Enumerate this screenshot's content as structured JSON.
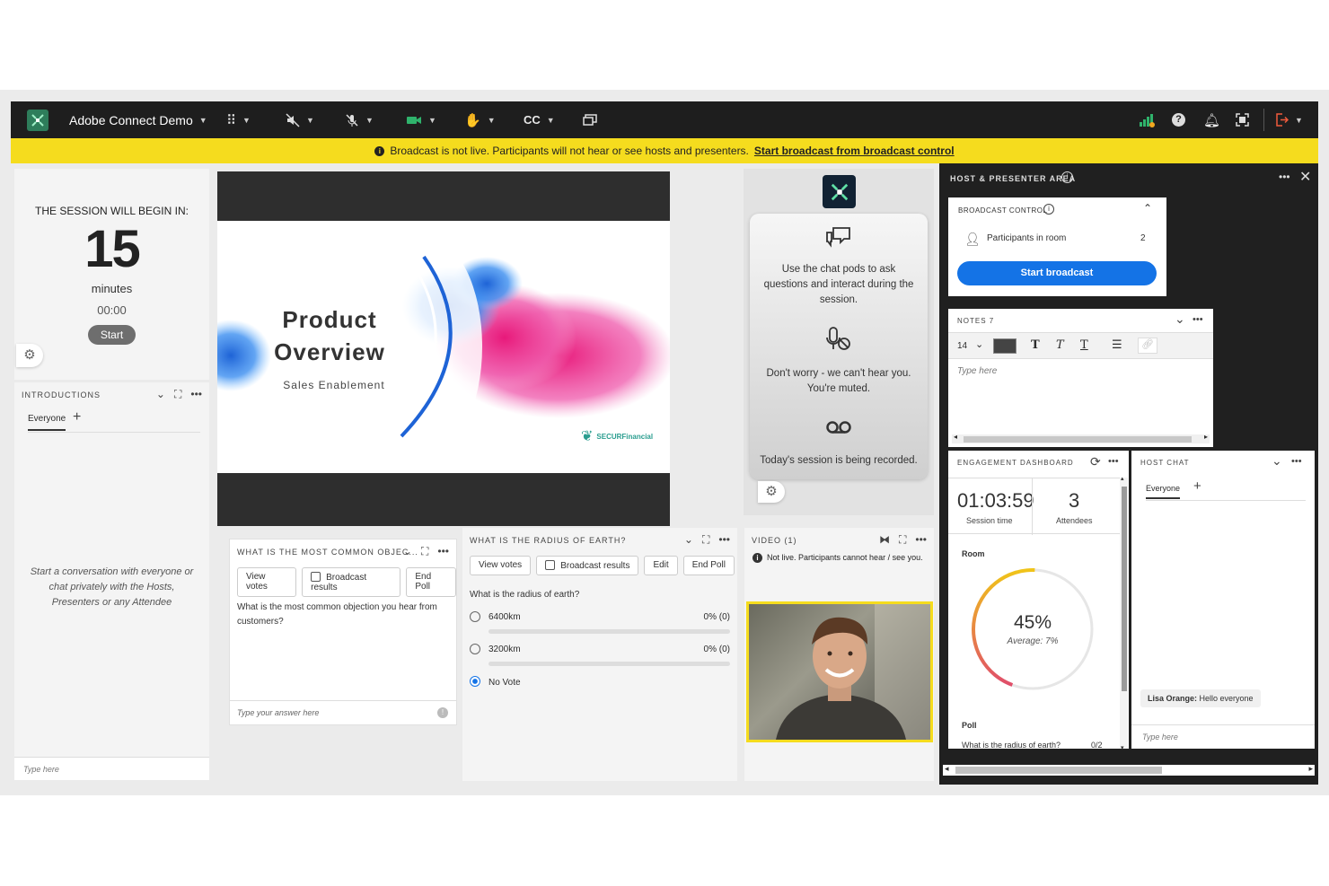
{
  "app": {
    "title": "Adobe Connect Demo",
    "cc_label": "CC"
  },
  "banner": {
    "message": "Broadcast is not live. Participants will not hear or see hosts and presenters.",
    "link": "Start broadcast from broadcast control"
  },
  "timer": {
    "heading": "THE SESSION WILL BEGIN IN:",
    "minutes_value": "15",
    "minutes_label": "minutes",
    "clock": "00:00",
    "start_label": "Start"
  },
  "intro": {
    "title": "INTRODUCTIONS",
    "tab": "Everyone",
    "empty_text": "Start a conversation with everyone or chat privately with the Hosts, Presenters or any Attendee",
    "placeholder": "Type here"
  },
  "slide": {
    "title_line1": "Product",
    "title_line2": "Overview",
    "subtitle": "Sales Enablement",
    "logo_text": "SECURFinancial"
  },
  "info": {
    "chat_tip": "Use the chat pods to ask questions and interact during the session.",
    "mute_tip": "Don't worry - we can't hear you. You're muted.",
    "record_tip": "Today's session is being recorded."
  },
  "poll1": {
    "title": "WHAT IS THE MOST COMMON OBJEC...",
    "view_votes": "View votes",
    "broadcast": "Broadcast results",
    "end_poll": "End Poll",
    "question": "What is the most common objection you hear from customers?",
    "placeholder": "Type your answer here"
  },
  "poll2": {
    "title": "WHAT IS THE RADIUS OF EARTH?",
    "view_votes": "View votes",
    "broadcast": "Broadcast results",
    "edit": "Edit",
    "end_poll": "End Poll",
    "question": "What is the radius of earth?",
    "options": [
      {
        "label": "6400km",
        "result": "0% (0)"
      },
      {
        "label": "3200km",
        "result": "0% (0)"
      },
      {
        "label": "No Vote"
      }
    ]
  },
  "video": {
    "title": "VIDEO (1)",
    "status": "Not live. Participants cannot hear / see you."
  },
  "host_area": {
    "title": "HOST & PRESENTER AREA"
  },
  "broadcast": {
    "title": "BROADCAST CONTROL",
    "participants_label": "Participants in room",
    "participants_count": "2",
    "start_label": "Start broadcast"
  },
  "notes": {
    "title": "NOTES 7",
    "font_size": "14",
    "placeholder": "Type here"
  },
  "engagement": {
    "title": "ENGAGEMENT DASHBOARD",
    "session_time": "01:03:59",
    "session_time_label": "Session time",
    "attendees": "3",
    "attendees_label": "Attendees",
    "room_label": "Room",
    "percent": "45%",
    "average": "Average: 7%",
    "percent_value": 0.45,
    "poll_label": "Poll",
    "poll_question": "What is the radius of earth?",
    "poll_count": "0/2"
  },
  "host_chat": {
    "title": "HOST CHAT",
    "tab": "Everyone",
    "message_author": "Lisa Orange:",
    "message_text": "Hello everyone",
    "placeholder": "Type here"
  },
  "colors": {
    "accent_blue": "#1473e6",
    "banner_yellow": "#f5dc1e",
    "topbar": "#1e1e1e",
    "gauge_start": "#f0c419",
    "gauge_end": "#e04e6a"
  }
}
